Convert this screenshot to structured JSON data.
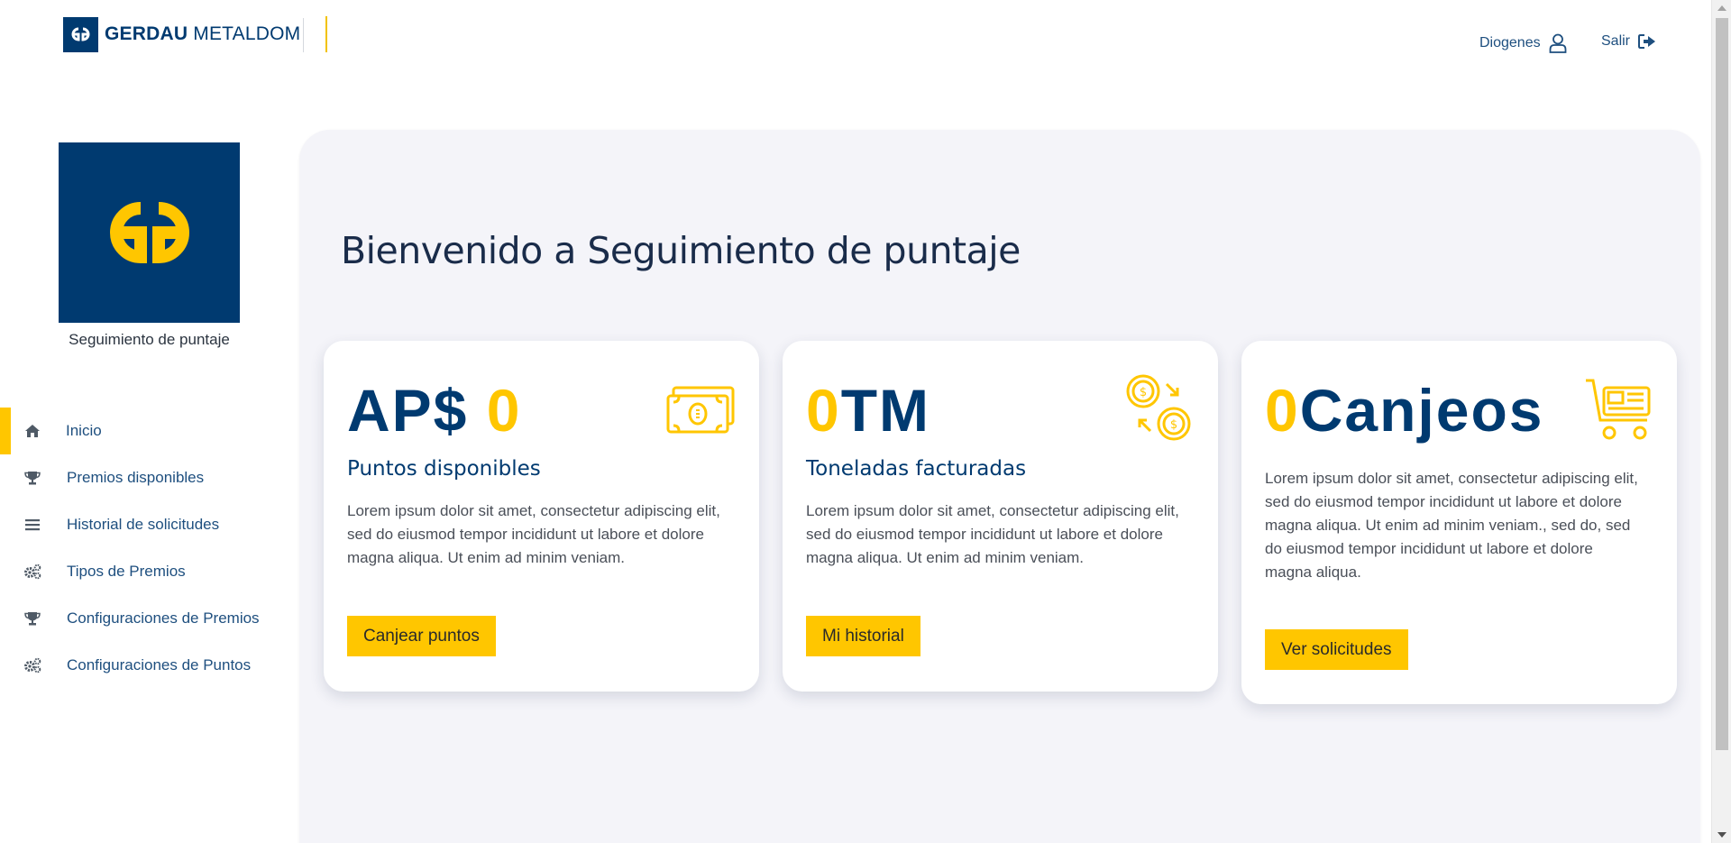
{
  "header": {
    "brand_name_bold": "GERDAU",
    "brand_name_light": "METALDOM",
    "user_name": "Diogenes",
    "logout_label": "Salir"
  },
  "sidebar": {
    "caption": "Seguimiento de puntaje",
    "items": [
      {
        "label": "Inicio",
        "icon": "home-icon",
        "active": true
      },
      {
        "label": "Premios disponibles",
        "icon": "trophy-icon"
      },
      {
        "label": "Historial de solicitudes",
        "icon": "list-icon"
      },
      {
        "label": "Tipos de Premios",
        "icon": "gears-icon"
      },
      {
        "label": "Configuraciones de Premios",
        "icon": "trophy-icon"
      },
      {
        "label": "Configuraciones de Puntos",
        "icon": "gears-icon"
      }
    ]
  },
  "main": {
    "welcome": "Bienvenido a Seguimiento de puntaje",
    "cards": [
      {
        "stat_prefix": "AP$",
        "stat_value": "0",
        "title": "Puntos disponibles",
        "description": "Lorem ipsum dolor sit amet, consectetur adipiscing elit, sed do eiusmod tempor incididunt ut labore et dolore magna aliqua. Ut enim ad minim veniam.",
        "button": "Canjear puntos",
        "icon": "money-icon"
      },
      {
        "stat_value": "0",
        "stat_suffix": "TM",
        "title": "Toneladas facturadas",
        "description": "Lorem ipsum dolor sit amet, consectetur adipiscing elit, sed do eiusmod tempor incididunt ut labore et dolore magna aliqua. Ut enim ad minim veniam.",
        "button": "Mi historial",
        "icon": "coin-exchange-icon"
      },
      {
        "stat_value": "0",
        "stat_suffix": "Canjeos",
        "description": "Lorem ipsum dolor sit amet, consectetur adipiscing elit, sed do eiusmod tempor incididunt ut labore et dolore magna aliqua. Ut enim ad minim veniam., sed do, sed do eiusmod tempor incididunt ut labore et dolore magna aliqua.",
        "button": "Ver solicitudes",
        "icon": "cart-icon"
      }
    ]
  },
  "colors": {
    "brand_blue": "#003a70",
    "accent_yellow": "#ffc600",
    "panel_bg": "#f4f4f9"
  }
}
